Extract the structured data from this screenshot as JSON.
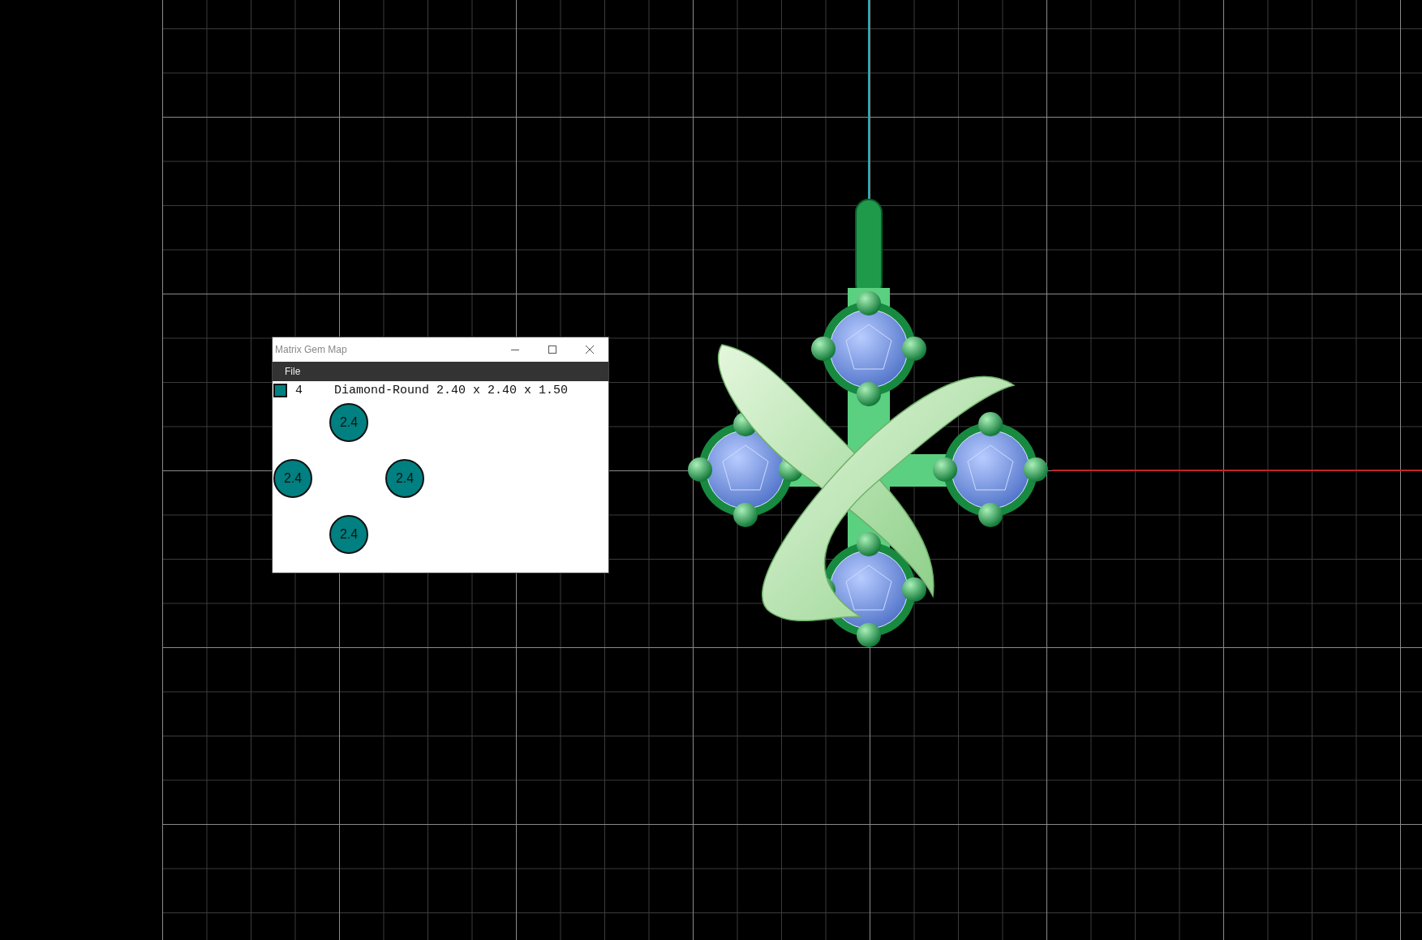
{
  "gem_map_window": {
    "title": "Matrix Gem Map",
    "menu": [
      "File"
    ],
    "legend": {
      "count": "4",
      "description": "Diamond-Round 2.40 x 2.40 x 1.50",
      "color": "#008080"
    },
    "gems": [
      {
        "label": "2.4"
      },
      {
        "label": "2.4"
      },
      {
        "label": "2.4"
      },
      {
        "label": "2.4"
      }
    ]
  }
}
